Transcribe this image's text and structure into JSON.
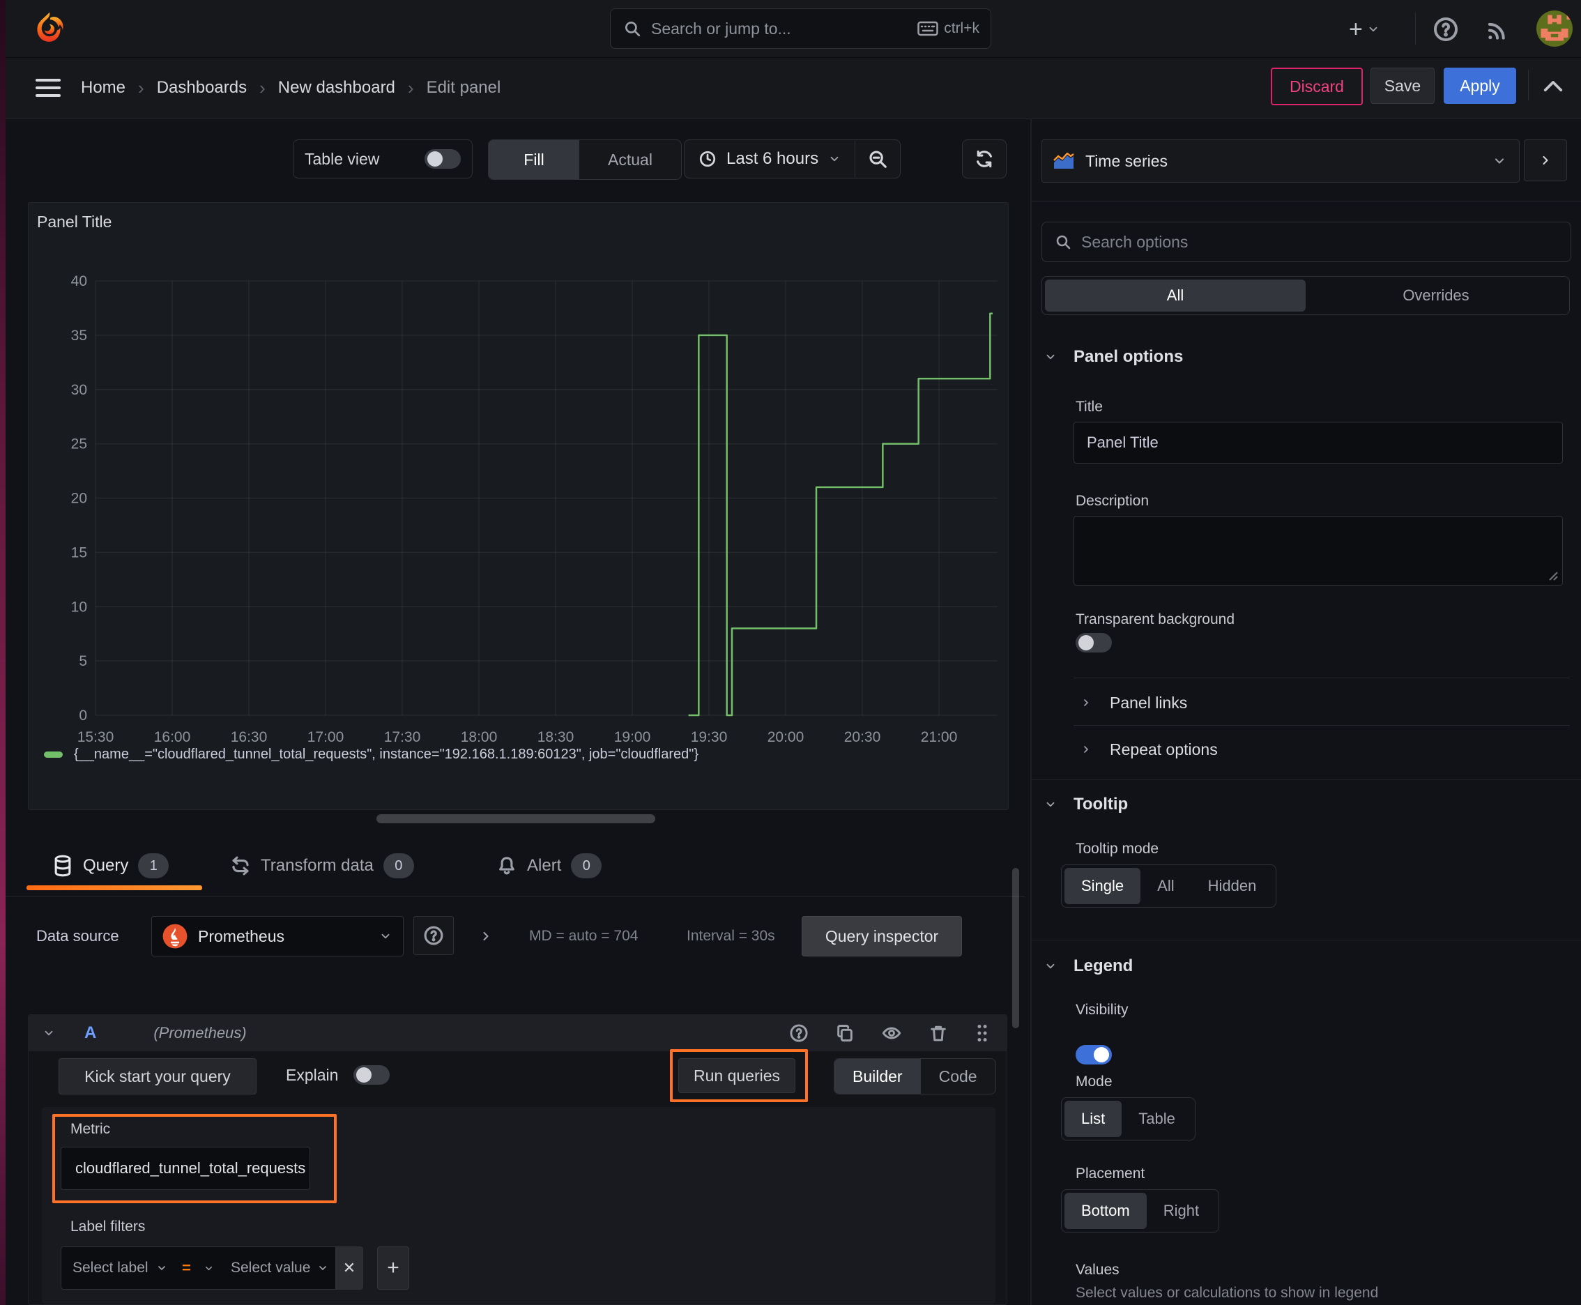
{
  "topbar": {
    "search_placeholder": "Search or jump to...",
    "search_shortcut": "ctrl+k"
  },
  "breadcrumb": {
    "items": [
      "Home",
      "Dashboards",
      "New dashboard",
      "Edit panel"
    ]
  },
  "actions": {
    "discard": "Discard",
    "save": "Save",
    "apply": "Apply"
  },
  "toolbar": {
    "table_view": "Table view",
    "fill": "Fill",
    "actual": "Actual",
    "time_range": "Last 6 hours"
  },
  "panel": {
    "title": "Panel Title"
  },
  "chart_data": {
    "type": "line",
    "subtype": "step-after time series",
    "title": "Panel Title",
    "x_ticks": [
      "15:30",
      "16:00",
      "16:30",
      "17:00",
      "17:30",
      "18:00",
      "18:30",
      "19:00",
      "19:30",
      "20:00",
      "20:30",
      "21:00"
    ],
    "y_ticks": [
      0,
      5,
      10,
      15,
      20,
      25,
      30,
      35,
      40
    ],
    "ylim": [
      0,
      40
    ],
    "grid": true,
    "legend_position": "bottom",
    "series": [
      {
        "name": "{__name__=\"cloudflared_tunnel_total_requests\", instance=\"192.168.1.189:60123\", job=\"cloudflared\"}",
        "color": "#73bf69",
        "points": [
          {
            "t": "19:22",
            "v": 0
          },
          {
            "t": "19:26",
            "v": 35
          },
          {
            "t": "19:37",
            "v": 0
          },
          {
            "t": "19:39",
            "v": 8
          },
          {
            "t": "20:12",
            "v": 21
          },
          {
            "t": "20:38",
            "v": 25
          },
          {
            "t": "20:52",
            "v": 31
          },
          {
            "t": "21:20",
            "v": 37
          },
          {
            "t": "21:21",
            "v": 37
          }
        ]
      }
    ]
  },
  "tabs": {
    "query": {
      "label": "Query",
      "count": "1"
    },
    "transform": {
      "label": "Transform data",
      "count": "0"
    },
    "alert": {
      "label": "Alert",
      "count": "0"
    }
  },
  "datasource_row": {
    "label": "Data source",
    "value": "Prometheus",
    "stats_md": "MD = auto = 704",
    "stats_interval": "Interval = 30s",
    "inspector": "Query inspector"
  },
  "query_editor": {
    "ref_id": "A",
    "ds_hint": "(Prometheus)",
    "kickstart": "Kick start your query",
    "explain": "Explain",
    "run": "Run queries",
    "builder": "Builder",
    "code": "Code",
    "metric_label": "Metric",
    "metric_value": "cloudflared_tunnel_total_requests",
    "label_filters_label": "Label filters",
    "select_label": "Select label",
    "operator": "=",
    "select_value": "Select value",
    "remove": "✕",
    "add": "+"
  },
  "options_pane": {
    "viz": "Time series",
    "search_placeholder": "Search options",
    "tab_all": "All",
    "tab_overrides": "Overrides",
    "panel_options": {
      "title": "Panel options",
      "title_label": "Title",
      "title_value": "Panel Title",
      "description_label": "Description",
      "transparent_label": "Transparent background"
    },
    "panel_links": "Panel links",
    "repeat_options": "Repeat options",
    "tooltip": {
      "title": "Tooltip",
      "mode_label": "Tooltip mode",
      "modes": [
        "Single",
        "All",
        "Hidden"
      ],
      "selected": "Single"
    },
    "legend": {
      "title": "Legend",
      "visibility_label": "Visibility",
      "mode_label": "Mode",
      "modes": [
        "List",
        "Table"
      ],
      "selected_mode": "List",
      "placement_label": "Placement",
      "placements": [
        "Bottom",
        "Right"
      ],
      "selected_placement": "Bottom",
      "values_label": "Values",
      "values_hint": "Select values or calculations to show in legend"
    }
  },
  "colors": {
    "accent_blue": "#3d71d9",
    "series_green": "#73bf69",
    "annotation_orange": "#ff7126",
    "discard_pink": "#e0226c",
    "tab_underline_from": "#ff6a13",
    "tab_underline_to": "#ff9830",
    "prometheus_orange": "#e6522c"
  }
}
